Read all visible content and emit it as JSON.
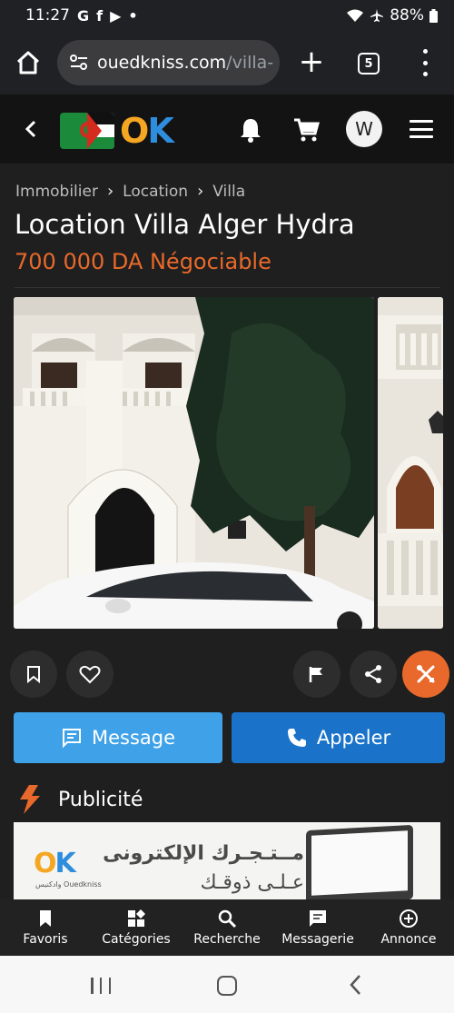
{
  "status_bar": {
    "time": "11:27",
    "notification_icons": [
      "G",
      "f",
      "▶",
      "•"
    ],
    "battery": "88%"
  },
  "browser": {
    "url_domain": "ouedkniss.com",
    "url_rest": "/villa-",
    "tab_count": "5"
  },
  "header": {
    "logo_text_o": "O",
    "logo_text_k": "K",
    "avatar_initial": "W"
  },
  "breadcrumb": {
    "items": [
      "Immobilier",
      "Location",
      "Villa"
    ]
  },
  "listing": {
    "title": "Location Villa Alger Hydra",
    "price": "700 000 DA Négociable"
  },
  "buttons": {
    "message": "Message",
    "call": "Appeler"
  },
  "ad": {
    "section_label": "Publicité",
    "logo_o": "O",
    "logo_k": "K",
    "logo_sub": "وادكنيس Ouedkniss",
    "line1": "مــتـجـرك الإلكترونى",
    "line2": "عـلـى ذوقـك"
  },
  "bottom_nav": {
    "items": [
      {
        "label": "Favoris",
        "icon": "bookmark-icon"
      },
      {
        "label": "Catégories",
        "icon": "categories-icon"
      },
      {
        "label": "Recherche",
        "icon": "search-icon"
      },
      {
        "label": "Messagerie",
        "icon": "chat-icon"
      },
      {
        "label": "Annonce",
        "icon": "add-circle-icon"
      }
    ]
  },
  "colors": {
    "accent_orange": "#e8692b",
    "message_blue": "#3fa2e8",
    "call_blue": "#1a73c8",
    "logo_orange": "#f5a623",
    "logo_blue": "#2f8dde"
  }
}
